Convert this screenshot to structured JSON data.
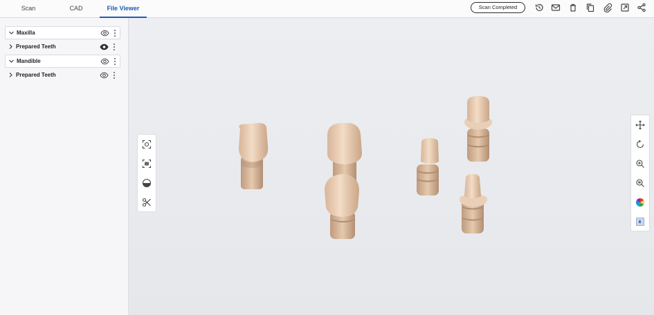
{
  "tabs": [
    {
      "label": "Scan"
    },
    {
      "label": "CAD"
    },
    {
      "label": "File Viewer",
      "active": true
    }
  ],
  "header": {
    "status_label": "Scan Completed",
    "toolbar_icons": [
      "history-icon",
      "mail-icon",
      "trash-icon",
      "copy-icon",
      "attach-icon",
      "export-icon",
      "share-icon"
    ]
  },
  "sidebar": {
    "items": [
      {
        "label": "Maxilla",
        "expanded": true
      },
      {
        "label": "Prepared Teeth",
        "expanded": false
      },
      {
        "label": "Mandible",
        "expanded": true
      },
      {
        "label": "Prepared Teeth",
        "expanded": false
      }
    ]
  },
  "viewport": {
    "left_tools": [
      "fit-view-icon",
      "frame-select-icon",
      "half-sphere-icon",
      "scissors-icon"
    ],
    "right_tools": [
      "pan-icon",
      "rotate-icon",
      "zoom-in-icon",
      "zoom-area-icon",
      "color-map-icon",
      "texture-icon"
    ]
  },
  "colors": {
    "accent": "#1e5bb5",
    "tooth": "#e8cdb2",
    "background": "#e7e8ec"
  }
}
